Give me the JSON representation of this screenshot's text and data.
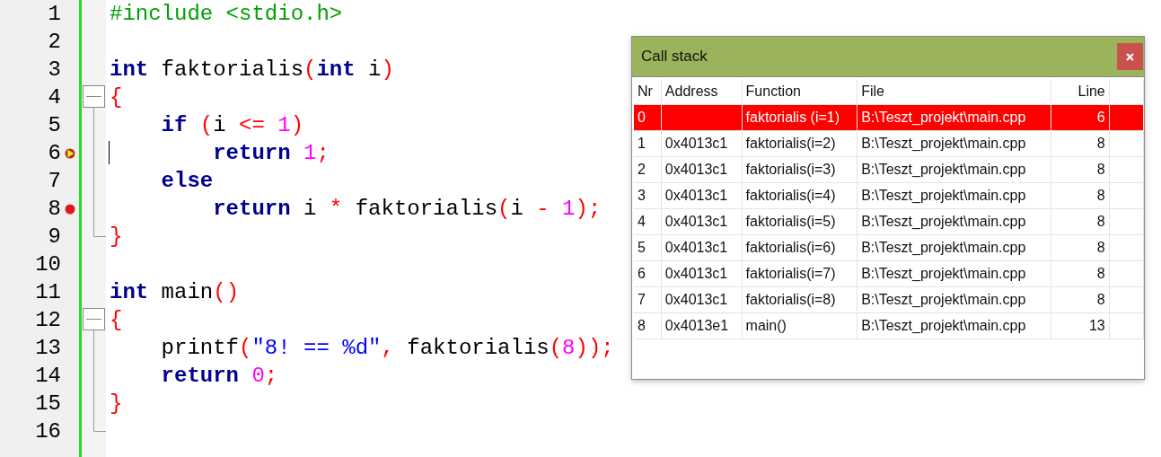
{
  "editor": {
    "lines": [
      {
        "number": "1",
        "breakpoint": false,
        "current": false,
        "cursor": false,
        "tokens": [
          {
            "kind": "pre",
            "text": "#include <stdio.h>"
          }
        ]
      },
      {
        "number": "2",
        "breakpoint": false,
        "current": false,
        "cursor": false
      },
      {
        "number": "3",
        "breakpoint": false,
        "current": false,
        "cursor": false,
        "tokens": [
          {
            "kind": "kw",
            "text": "int"
          },
          {
            "kind": "id",
            "text": " faktorialis"
          },
          {
            "kind": "op",
            "text": "("
          },
          {
            "kind": "kw",
            "text": "int"
          },
          {
            "kind": "id",
            "text": " i"
          },
          {
            "kind": "op",
            "text": ")"
          }
        ]
      },
      {
        "number": "4",
        "breakpoint": false,
        "current": false,
        "cursor": false,
        "tokens": [
          {
            "kind": "op",
            "text": "{"
          }
        ],
        "children": [
          {
            "number": "5",
            "breakpoint": false,
            "current": false,
            "cursor": false,
            "tokens": [
              {
                "kind": "kw",
                "text": "    if"
              },
              {
                "kind": "op",
                "text": " ("
              },
              {
                "kind": "id",
                "text": "i "
              },
              {
                "kind": "op",
                "text": "<="
              },
              {
                "kind": "num",
                "text": " 1"
              },
              {
                "kind": "op",
                "text": ")"
              }
            ]
          },
          {
            "number": "6",
            "breakpoint": true,
            "current": true,
            "cursor": true,
            "tokens": [
              {
                "kind": "kw",
                "text": "        return"
              },
              {
                "kind": "num",
                "text": " 1"
              },
              {
                "kind": "op",
                "text": ";"
              }
            ]
          },
          {
            "number": "7",
            "breakpoint": false,
            "current": false,
            "cursor": false,
            "tokens": [
              {
                "kind": "kw",
                "text": "    else"
              }
            ]
          },
          {
            "number": "8",
            "breakpoint": true,
            "current": false,
            "cursor": false,
            "tokens": [
              {
                "kind": "kw",
                "text": "        return"
              },
              {
                "kind": "id",
                "text": " i "
              },
              {
                "kind": "op",
                "text": "*"
              },
              {
                "kind": "id",
                "text": " faktorialis"
              },
              {
                "kind": "op",
                "text": "("
              },
              {
                "kind": "id",
                "text": "i "
              },
              {
                "kind": "op",
                "text": "-"
              },
              {
                "kind": "num",
                "text": " 1"
              },
              {
                "kind": "op",
                "text": ");"
              }
            ]
          },
          {
            "number": "9",
            "breakpoint": false,
            "current": false,
            "cursor": false,
            "tokens": [
              {
                "kind": "op",
                "text": "}"
              }
            ]
          }
        ]
      },
      {
        "number": "10",
        "breakpoint": false,
        "current": false,
        "cursor": false
      },
      {
        "number": "11",
        "breakpoint": false,
        "current": false,
        "cursor": false,
        "tokens": [
          {
            "kind": "kw",
            "text": "int"
          },
          {
            "kind": "id",
            "text": " main"
          },
          {
            "kind": "op",
            "text": "()"
          }
        ]
      },
      {
        "number": "12",
        "breakpoint": false,
        "current": false,
        "cursor": false,
        "tokens": [
          {
            "kind": "op",
            "text": "{"
          }
        ],
        "children": [
          {
            "number": "13",
            "breakpoint": false,
            "current": false,
            "cursor": false,
            "tokens": [
              {
                "kind": "id",
                "text": "    printf"
              },
              {
                "kind": "op",
                "text": "("
              },
              {
                "kind": "str",
                "text": "\"8! == %d\""
              },
              {
                "kind": "op",
                "text": ","
              },
              {
                "kind": "id",
                "text": " faktorialis"
              },
              {
                "kind": "op",
                "text": "("
              },
              {
                "kind": "num",
                "text": "8"
              },
              {
                "kind": "op",
                "text": "));"
              }
            ]
          },
          {
            "number": "14",
            "breakpoint": false,
            "current": false,
            "cursor": false,
            "tokens": [
              {
                "kind": "kw",
                "text": "    return"
              },
              {
                "kind": "num",
                "text": " 0"
              },
              {
                "kind": "op",
                "text": ";"
              }
            ]
          },
          {
            "number": "15",
            "breakpoint": false,
            "current": false,
            "cursor": false,
            "tokens": [
              {
                "kind": "op",
                "text": "}"
              }
            ]
          },
          {
            "number": "16",
            "breakpoint": false,
            "current": false,
            "cursor": false
          }
        ]
      }
    ]
  },
  "call_stack": {
    "title": "Call stack",
    "columns": [
      "Nr",
      "Address",
      "Function",
      "File",
      "Line"
    ],
    "rows": [
      {
        "selected": true,
        "cells": [
          "0",
          "",
          "faktorialis (i=1)",
          "B:\\Teszt_projekt\\main.cpp",
          "6"
        ]
      },
      {
        "selected": false,
        "cells": [
          "1",
          "0x4013c1",
          "faktorialis(i=2)",
          "B:\\Teszt_projekt\\main.cpp",
          "8"
        ]
      },
      {
        "selected": false,
        "cells": [
          "2",
          "0x4013c1",
          "faktorialis(i=3)",
          "B:\\Teszt_projekt\\main.cpp",
          "8"
        ]
      },
      {
        "selected": false,
        "cells": [
          "3",
          "0x4013c1",
          "faktorialis(i=4)",
          "B:\\Teszt_projekt\\main.cpp",
          "8"
        ]
      },
      {
        "selected": false,
        "cells": [
          "4",
          "0x4013c1",
          "faktorialis(i=5)",
          "B:\\Teszt_projekt\\main.cpp",
          "8"
        ]
      },
      {
        "selected": false,
        "cells": [
          "5",
          "0x4013c1",
          "faktorialis(i=6)",
          "B:\\Teszt_projekt\\main.cpp",
          "8"
        ]
      },
      {
        "selected": false,
        "cells": [
          "6",
          "0x4013c1",
          "faktorialis(i=7)",
          "B:\\Teszt_projekt\\main.cpp",
          "8"
        ]
      },
      {
        "selected": false,
        "cells": [
          "7",
          "0x4013c1",
          "faktorialis(i=8)",
          "B:\\Teszt_projekt\\main.cpp",
          "8"
        ]
      },
      {
        "selected": false,
        "cells": [
          "8",
          "0x4013e1",
          "main()",
          "B:\\Teszt_projekt\\main.cpp",
          "13"
        ]
      }
    ]
  }
}
